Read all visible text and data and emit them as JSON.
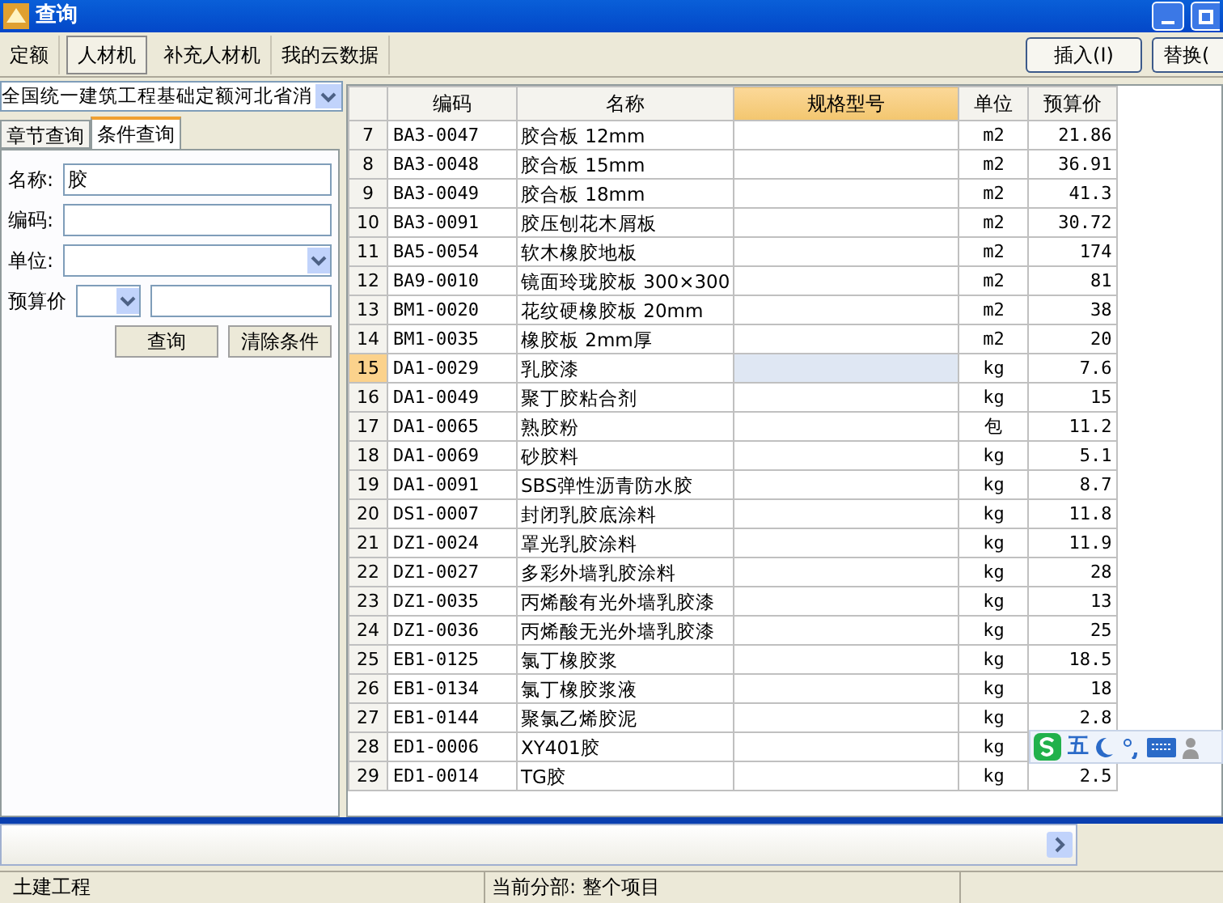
{
  "window": {
    "title": "查询"
  },
  "toolbar": {
    "tabs": [
      {
        "label": "定额",
        "selected": false
      },
      {
        "label": "人材机",
        "selected": true
      },
      {
        "label": "补充人材机",
        "selected": false
      },
      {
        "label": "我的云数据",
        "selected": false
      }
    ],
    "buttons": [
      "插入(I)",
      "替换("
    ]
  },
  "left_panel": {
    "library": "全国统一建筑工程基础定额河北省消",
    "tabs": [
      {
        "label": "章节查询",
        "selected": false
      },
      {
        "label": "条件查询",
        "selected": true
      }
    ],
    "fields": [
      {
        "kind": "text",
        "label": "名称:",
        "value": "胶"
      },
      {
        "kind": "text",
        "label": "编码:"
      },
      {
        "kind": "select",
        "label": "单位:"
      },
      {
        "kind": "price",
        "label": "预算价"
      }
    ],
    "buttons": [
      "查询",
      "清除条件"
    ]
  },
  "table": {
    "columns": [
      "编码",
      "名称",
      "规格型号",
      "单位",
      "预算价"
    ],
    "rows": [
      {
        "no": "7",
        "code": "BA3-0047",
        "name": "胶合板 12mm",
        "unit": "m2",
        "price": "21.86",
        "selected": false
      },
      {
        "no": "8",
        "code": "BA3-0048",
        "name": "胶合板 15mm",
        "unit": "m2",
        "price": "36.91",
        "selected": false
      },
      {
        "no": "9",
        "code": "BA3-0049",
        "name": "胶合板 18mm",
        "unit": "m2",
        "price": "41.3",
        "selected": false
      },
      {
        "no": "10",
        "code": "BA3-0091",
        "name": "胶压刨花木屑板",
        "unit": "m2",
        "price": "30.72",
        "selected": false
      },
      {
        "no": "11",
        "code": "BA5-0054",
        "name": "软木橡胶地板",
        "unit": "m2",
        "price": "174",
        "selected": false
      },
      {
        "no": "12",
        "code": "BA9-0010",
        "name": "镜面玲珑胶板 300×300",
        "unit": "m2",
        "price": "81",
        "selected": false
      },
      {
        "no": "13",
        "code": "BM1-0020",
        "name": "花纹硬橡胶板 20mm",
        "unit": "m2",
        "price": "38",
        "selected": false
      },
      {
        "no": "14",
        "code": "BM1-0035",
        "name": "橡胶板 2mm厚",
        "unit": "m2",
        "price": "20",
        "selected": false
      },
      {
        "no": "15",
        "code": "DA1-0029",
        "name": "乳胶漆",
        "unit": "kg",
        "price": "7.6",
        "selected": true
      },
      {
        "no": "16",
        "code": "DA1-0049",
        "name": "聚丁胶粘合剂",
        "unit": "kg",
        "price": "15",
        "selected": false
      },
      {
        "no": "17",
        "code": "DA1-0065",
        "name": "熟胶粉",
        "unit": "包",
        "price": "11.2",
        "selected": false
      },
      {
        "no": "18",
        "code": "DA1-0069",
        "name": "砂胶料",
        "unit": "kg",
        "price": "5.1",
        "selected": false
      },
      {
        "no": "19",
        "code": "DA1-0091",
        "name": "SBS弹性沥青防水胶",
        "unit": "kg",
        "price": "8.7",
        "selected": false
      },
      {
        "no": "20",
        "code": "DS1-0007",
        "name": "封闭乳胶底涂料",
        "unit": "kg",
        "price": "11.8",
        "selected": false
      },
      {
        "no": "21",
        "code": "DZ1-0024",
        "name": "罩光乳胶涂料",
        "unit": "kg",
        "price": "11.9",
        "selected": false
      },
      {
        "no": "22",
        "code": "DZ1-0027",
        "name": "多彩外墙乳胶涂料",
        "unit": "kg",
        "price": "28",
        "selected": false
      },
      {
        "no": "23",
        "code": "DZ1-0035",
        "name": "丙烯酸有光外墙乳胶漆",
        "unit": "kg",
        "price": "13",
        "selected": false
      },
      {
        "no": "24",
        "code": "DZ1-0036",
        "name": "丙烯酸无光外墙乳胶漆",
        "unit": "kg",
        "price": "25",
        "selected": false
      },
      {
        "no": "25",
        "code": "EB1-0125",
        "name": "氯丁橡胶浆",
        "unit": "kg",
        "price": "18.5",
        "selected": false
      },
      {
        "no": "26",
        "code": "EB1-0134",
        "name": "氯丁橡胶浆液",
        "unit": "kg",
        "price": "18",
        "selected": false
      },
      {
        "no": "27",
        "code": "EB1-0144",
        "name": "聚氯乙烯胶泥",
        "unit": "kg",
        "price": "2.8",
        "selected": false
      },
      {
        "no": "28",
        "code": "ED1-0006",
        "name": "XY401胶",
        "unit": "kg",
        "selected": false
      },
      {
        "no": "29",
        "code": "ED1-0014",
        "name": "TG胶",
        "unit": "kg",
        "price": "2.5",
        "selected": false
      }
    ]
  },
  "ime_bar": {
    "mode": "五"
  },
  "status_bar": [
    "土建工程",
    "当前分部: 整个项目"
  ]
}
